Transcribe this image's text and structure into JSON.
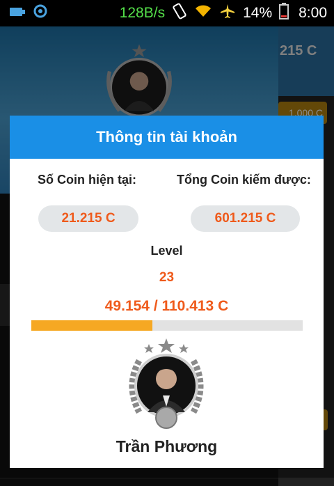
{
  "statusbar": {
    "speed": "128B/s",
    "battery": "14%",
    "time": "8:00",
    "icons": [
      "usb-icon",
      "sync-icon",
      "phone-vibrate-icon",
      "wifi-icon",
      "airplane-icon",
      "battery-icon"
    ]
  },
  "background": {
    "side_coin": "215 C",
    "gold_badge": "1.000 C"
  },
  "dialog": {
    "title": "Thông tin tài khoản",
    "current_coin_label": "Số Coin hiện tại:",
    "total_coin_label": "Tổng Coin kiếm được:",
    "current_coin_value": "21.215 C",
    "total_coin_value": "601.215 C",
    "level_label": "Level",
    "level_value": "23",
    "progress_text": "49.154 / 110.413 C",
    "progress_fraction": 0.445,
    "user_name": "Trần Phương"
  },
  "colors": {
    "header": "#1a8fe6",
    "accent_orange": "#ef5a1b",
    "progress_fill": "#f6a823"
  }
}
